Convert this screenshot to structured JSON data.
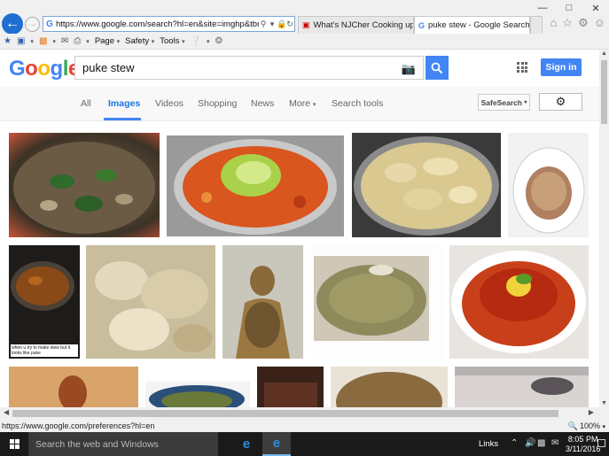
{
  "browser": {
    "url": "https://www.google.com/search?hl=en&site=imghp&tbm=is",
    "tabs": [
      {
        "title": "What's NJCher Cooking up N...",
        "active": false
      },
      {
        "title": "puke stew - Google Search",
        "active": true
      }
    ],
    "command_bar": {
      "page": "Page",
      "safety": "Safety",
      "tools": "Tools"
    },
    "status_url": "https://www.google.com/preferences?hl=en",
    "zoom": "100%"
  },
  "google": {
    "logo": [
      "G",
      "o",
      "o",
      "g",
      "l",
      "e"
    ],
    "query": "puke stew",
    "sign_in": "Sign in",
    "tabs": [
      "All",
      "Images",
      "Videos",
      "Shopping",
      "News",
      "More",
      "Search tools"
    ],
    "active_tab": "Images",
    "safesearch": "SafeSearch"
  },
  "images": [
    {
      "name": "spinach stew in pot"
    },
    {
      "name": "orange soup with celery"
    },
    {
      "name": "dumpling stew in pan"
    },
    {
      "name": "toilet bowl"
    },
    {
      "name": "crock pot stew",
      "caption": "when u try to make stew but it looks like puke"
    },
    {
      "name": "creamy chicken stew"
    },
    {
      "name": "person covered in mess"
    },
    {
      "name": "lentil dish on plate"
    },
    {
      "name": "tomato stew with lemon"
    },
    {
      "name": "vintage woman"
    },
    {
      "name": "green soup in patterned bowl"
    },
    {
      "name": "dark stew"
    },
    {
      "name": "broth in bowl"
    },
    {
      "name": "person lying on bed"
    }
  ],
  "taskbar": {
    "search_placeholder": "Search the web and Windows",
    "links": "Links",
    "time": "8:05 PM",
    "date": "3/11/2016"
  },
  "colors": {
    "google_blue": "#4285f4",
    "taskbar": "#1a1a1a"
  }
}
